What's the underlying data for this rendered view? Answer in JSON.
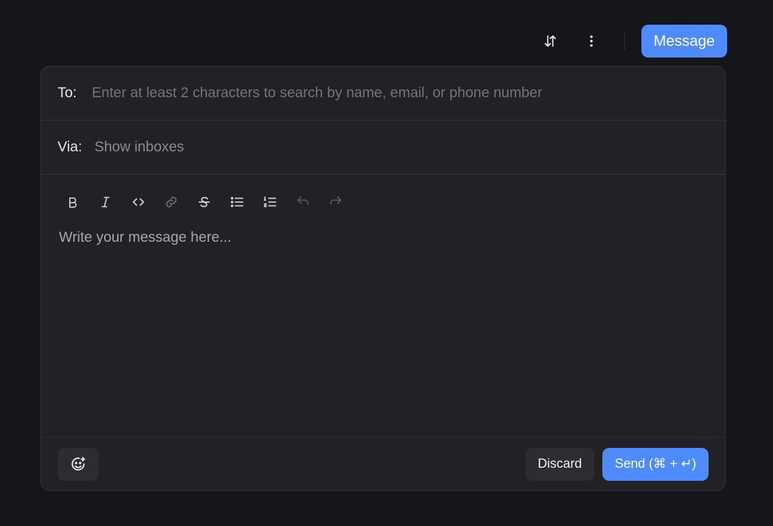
{
  "topbar": {
    "sort_icon": "sort-arrows-icon",
    "more_icon": "more-vertical-icon",
    "message_label": "Message"
  },
  "composer": {
    "to_label": "To:",
    "to_placeholder": "Enter at least 2 characters to search by name, email, or phone number",
    "via_label": "Via:",
    "via_placeholder": "Show inboxes",
    "toolbar": [
      {
        "name": "bold-icon"
      },
      {
        "name": "italic-icon"
      },
      {
        "name": "code-icon"
      },
      {
        "name": "link-icon"
      },
      {
        "name": "strikethrough-icon"
      },
      {
        "name": "bullet-list-icon"
      },
      {
        "name": "numbered-list-icon"
      },
      {
        "name": "undo-icon"
      },
      {
        "name": "redo-icon"
      }
    ],
    "message_placeholder": "Write your message here...",
    "emoji_icon": "emoji-add-icon",
    "discard_label": "Discard",
    "send_label": "Send (⌘ + ↵)"
  },
  "colors": {
    "background": "#151619",
    "panel": "#212126",
    "accent": "#4d8bff"
  }
}
